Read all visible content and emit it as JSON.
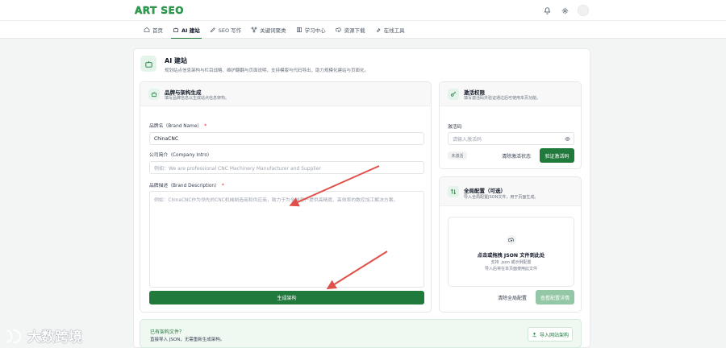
{
  "app": {
    "logo": "ART SEO"
  },
  "nav": [
    {
      "label": "首页",
      "icon": "home-icon"
    },
    {
      "label": "AI 建站",
      "icon": "robot-icon",
      "active": true
    },
    {
      "label": "SEO 写作",
      "icon": "pen-icon"
    },
    {
      "label": "关键词聚类",
      "icon": "network-icon"
    },
    {
      "label": "学习中心",
      "icon": "book-icon"
    },
    {
      "label": "资源下载",
      "icon": "cloud-download-icon"
    },
    {
      "label": "在线工具",
      "icon": "wrench-icon"
    }
  ],
  "page": {
    "title": "AI 建站",
    "desc": "规划站点信息架构与栏目战略、维护翻翻与页面说明，支持模版与代码导出，助力规模化建站与页面化。"
  },
  "brand_card": {
    "title": "品牌与架构生成",
    "desc": "填写品牌信息以生成站点信息架构。",
    "name_label": "品牌名（Brand Name）",
    "name_value": "ChinaCNC",
    "intro_label": "公司简介（Company Intro）",
    "intro_placeholder": "例如：We are professional CNC Machinery Manufacturer and Supplier",
    "desc_label": "品牌描述（Brand Description）",
    "desc_placeholder": "例如：ChinaCNC作为领先的CNC机械制造商和供应商，致力于为全球客户提供高精度、高效率的数控加工解决方案。",
    "generate_button": "生成架构"
  },
  "activation_card": {
    "title": "激活权限",
    "desc": "填写激活码并验证通过后可使用本页功能。",
    "code_label": "激活码",
    "code_placeholder": "请输入激活码",
    "status_badge": "未激活",
    "clear_button": "清除激活状态",
    "verify_button": "验证激活码"
  },
  "config_card": {
    "title": "全局配置（可选）",
    "desc": "导入全局配置JSON文件，用于页面生成。",
    "drop_title": "点击或拖拽 JSON 文件到此处",
    "drop_sub1": "支持 .json 或示例配置",
    "drop_sub2": "导入后将在本页面使用此文件",
    "clear_button": "清除全局配置",
    "view_button": "查看配置详情"
  },
  "import_bar": {
    "title": "已有架构文件？",
    "desc": "直接导入 JSON，无需重新生成架构。",
    "button": "导入网站架构"
  },
  "watermark": {
    "text": "大数跨境"
  },
  "colors": {
    "brand": "#1f7a3b",
    "accent": "#e5f4ea",
    "arrow": "#e0504a"
  }
}
